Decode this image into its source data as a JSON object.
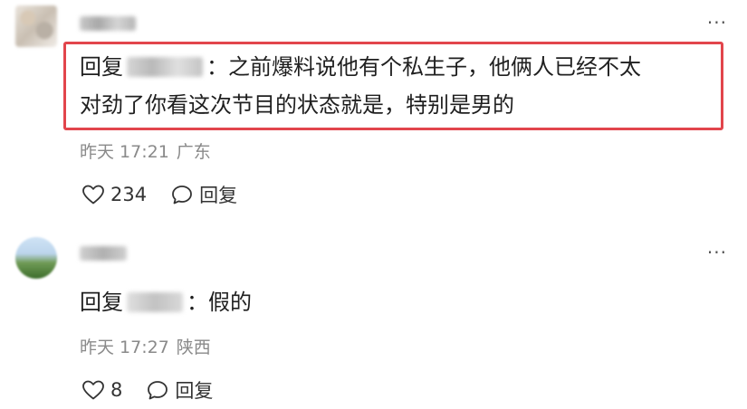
{
  "comments": [
    {
      "reply_prefix": "回复",
      "separator": "：",
      "text_line1": "之前爆料说他有个私生子，他俩人已经不太",
      "text_line2": "对劲了你看这次节目的状态就是，特别是男的",
      "time": "昨天 17:21",
      "location": "广东",
      "likes": "234",
      "reply_label": "回复",
      "more": "···"
    },
    {
      "reply_prefix": "回复",
      "separator": "：",
      "text_line1": "假的",
      "time": "昨天 17:27",
      "location": "陕西",
      "likes": "8",
      "reply_label": "回复",
      "more": "···"
    }
  ],
  "icons": {
    "like": "heart-outline-icon",
    "reply": "speech-bubble-icon",
    "more": "more-horizontal-icon"
  },
  "colors": {
    "highlight_border": "#e2454c",
    "meta_text": "#8a8a8a"
  }
}
